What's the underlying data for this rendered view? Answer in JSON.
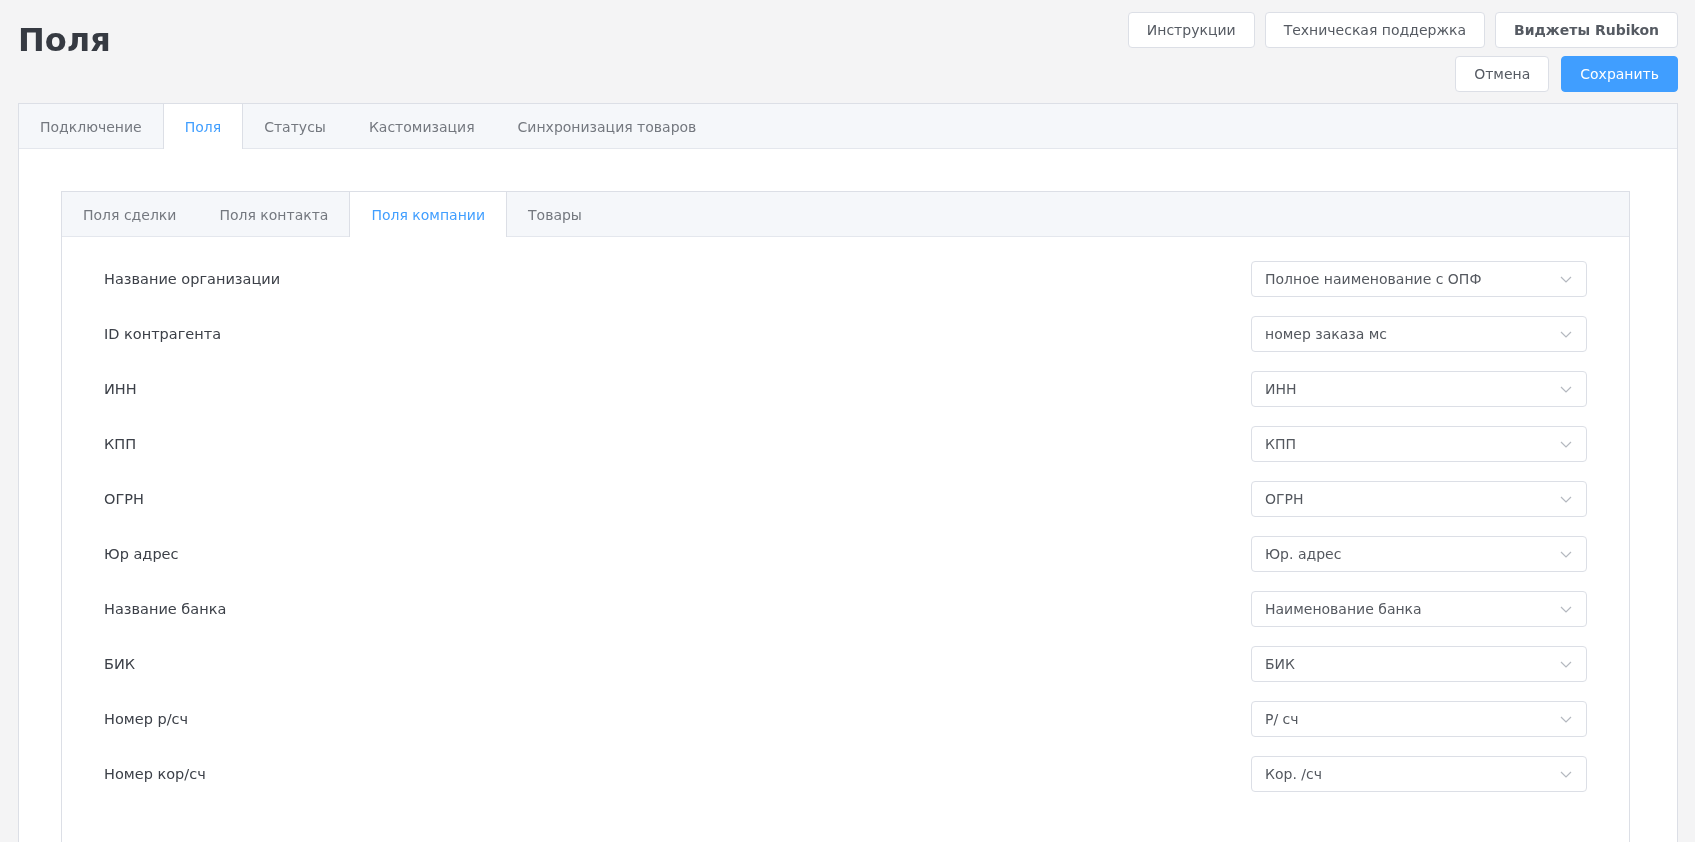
{
  "page": {
    "title": "Поля"
  },
  "header_buttons": [
    {
      "label": "Инструкции",
      "kind": "plain"
    },
    {
      "label": "Техническая поддержка",
      "kind": "plain"
    },
    {
      "label": "Виджеты Rubikon",
      "kind": "bold"
    }
  ],
  "action_buttons": [
    {
      "label": "Отмена",
      "kind": "secondary"
    },
    {
      "label": "Сохранить",
      "kind": "primary"
    }
  ],
  "tabs": [
    {
      "label": "Подключение",
      "selected": false
    },
    {
      "label": "Поля",
      "selected": true
    },
    {
      "label": "Статусы",
      "selected": false
    },
    {
      "label": "Кастомизация",
      "selected": false
    },
    {
      "label": "Синхронизация товаров",
      "selected": false
    }
  ],
  "subtabs": [
    {
      "label": "Поля сделки",
      "selected": false
    },
    {
      "label": "Поля контакта",
      "selected": false
    },
    {
      "label": "Поля компании",
      "selected": true
    },
    {
      "label": "Товары",
      "selected": false
    }
  ],
  "fields": [
    {
      "label": "Название организации",
      "value": "Полное наименование с ОПФ"
    },
    {
      "label": "ID контрагента",
      "value": "номер заказа мс"
    },
    {
      "label": "ИНН",
      "value": "ИНН"
    },
    {
      "label": "КПП",
      "value": "КПП"
    },
    {
      "label": "ОГРН",
      "value": "ОГРН"
    },
    {
      "label": "Юр адрес",
      "value": "Юр. адрес"
    },
    {
      "label": "Название банка",
      "value": "Наименование банка"
    },
    {
      "label": "БИК",
      "value": "БИК"
    },
    {
      "label": "Номер р/сч",
      "value": "Р/ сч"
    },
    {
      "label": "Номер кор/сч",
      "value": "Кор. /сч"
    }
  ]
}
